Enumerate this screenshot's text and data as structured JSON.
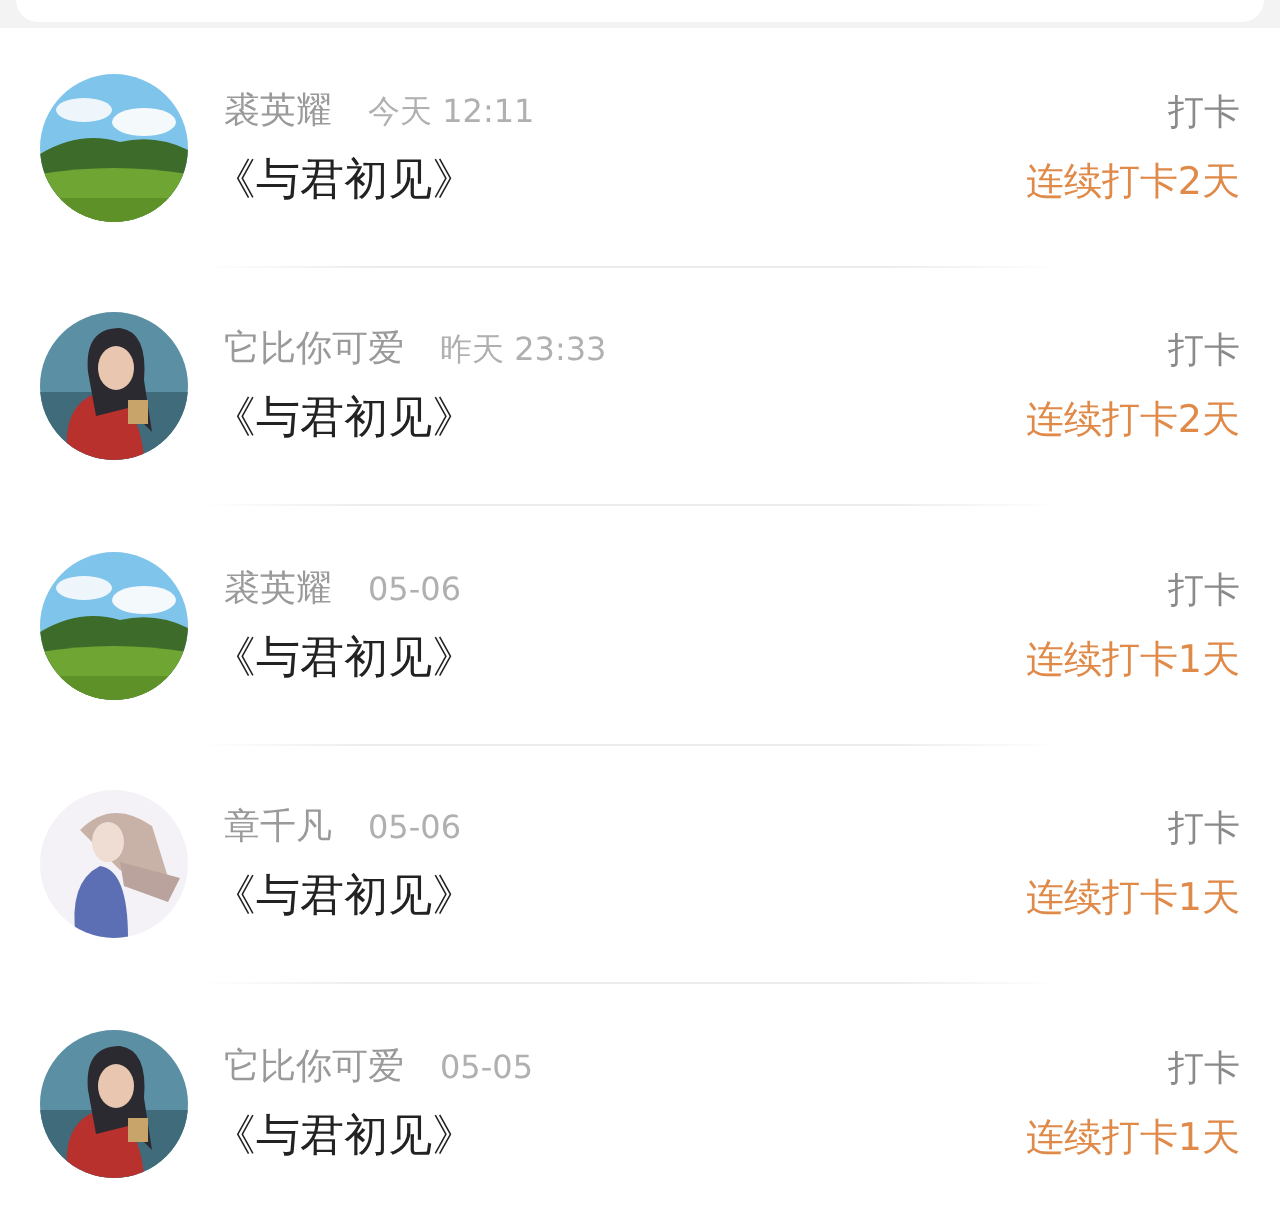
{
  "entries": [
    {
      "user": "裘英耀",
      "time": "今天 12:11",
      "title": "《与君初见》",
      "action": "打卡",
      "streak": "连续打卡2天"
    },
    {
      "user": "它比你可爱",
      "time": "昨天 23:33",
      "title": "《与君初见》",
      "action": "打卡",
      "streak": "连续打卡2天"
    },
    {
      "user": "裘英耀",
      "time": "05-06",
      "title": "《与君初见》",
      "action": "打卡",
      "streak": "连续打卡1天"
    },
    {
      "user": "章千凡",
      "time": "05-06",
      "title": "《与君初见》",
      "action": "打卡",
      "streak": "连续打卡1天"
    },
    {
      "user": "它比你可爱",
      "time": "05-05",
      "title": "《与君初见》",
      "action": "打卡",
      "streak": "连续打卡1天"
    }
  ]
}
